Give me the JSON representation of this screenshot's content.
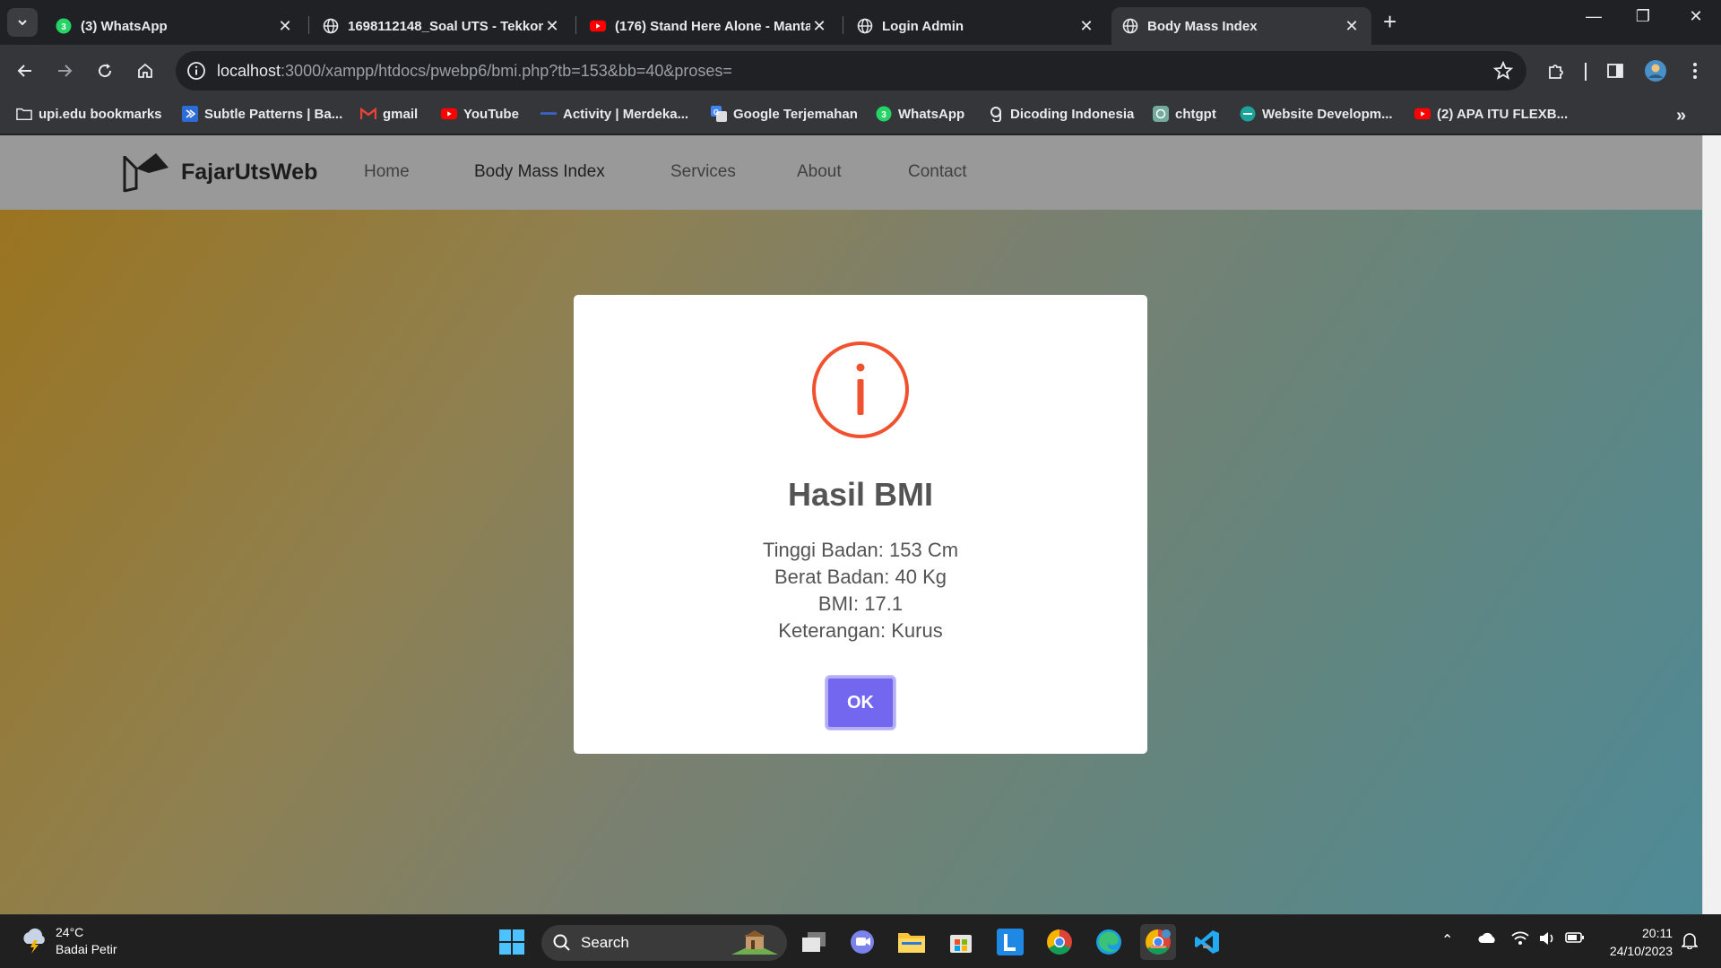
{
  "browser": {
    "tabs": [
      {
        "title": "(3) WhatsApp",
        "favicon": "whatsapp-icon",
        "active": false
      },
      {
        "title": "1698112148_Soal UTS - Tekkom",
        "favicon": "globe-icon",
        "active": false
      },
      {
        "title": "(176) Stand Here Alone - Manta",
        "favicon": "youtube-icon",
        "active": false
      },
      {
        "title": "Login Admin",
        "favicon": "globe-icon",
        "active": false
      },
      {
        "title": "Body Mass Index",
        "favicon": "globe-icon",
        "active": true
      }
    ],
    "url_host": "localhost",
    "url_rest": ":3000/xampp/htdocs/pwebp6/bmi.php?tb=153&bb=40&proses=",
    "bookmarks": [
      {
        "label": "upi.edu bookmarks",
        "icon": "folder-icon"
      },
      {
        "label": "Subtle Patterns | Ba...",
        "icon": "subtle-patterns-icon"
      },
      {
        "label": "gmail",
        "icon": "gmail-icon"
      },
      {
        "label": "YouTube",
        "icon": "youtube-icon"
      },
      {
        "label": "Activity | Merdeka...",
        "icon": "merdeka-icon"
      },
      {
        "label": "Google Terjemahan",
        "icon": "translate-icon"
      },
      {
        "label": "WhatsApp",
        "icon": "whatsapp-icon"
      },
      {
        "label": "Dicoding Indonesia",
        "icon": "dicoding-icon"
      },
      {
        "label": "chtgpt",
        "icon": "chatgpt-icon"
      },
      {
        "label": "Website Developm...",
        "icon": "website-icon"
      },
      {
        "label": "(2) APA ITU FLEXB...",
        "icon": "youtube-icon"
      }
    ]
  },
  "site": {
    "brand": "FajarUtsWeb",
    "nav": [
      "Home",
      "Body Mass Index",
      "Services",
      "About",
      "Contact"
    ],
    "active_nav": "Body Mass Index"
  },
  "modal": {
    "title": "Hasil BMI",
    "lines": [
      "Tinggi Badan: 153 Cm",
      "Berat Badan: 40 Kg",
      "BMI: 17.1",
      "Keterangan: Kurus"
    ],
    "ok_label": "OK",
    "accent": "#f27474",
    "button_color": "#7367f0"
  },
  "taskbar": {
    "temperature": "24°C",
    "weather": "Badai Petir",
    "search_label": "Search",
    "time": "20:11",
    "date": "24/10/2023"
  }
}
